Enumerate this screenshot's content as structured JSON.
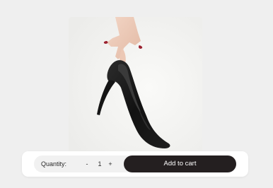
{
  "product": {
    "image_icon": "black-high-heel-shoe-held-by-hand"
  },
  "cart": {
    "quantity_label": "Quantity:",
    "decrement_label": "-",
    "quantity_value": "1",
    "increment_label": "+",
    "add_to_cart_label": "Add to cart"
  },
  "colors": {
    "background": "#efefef",
    "card": "#f6f6f4",
    "button": "#241f20",
    "pill": "#f1f1f1"
  }
}
